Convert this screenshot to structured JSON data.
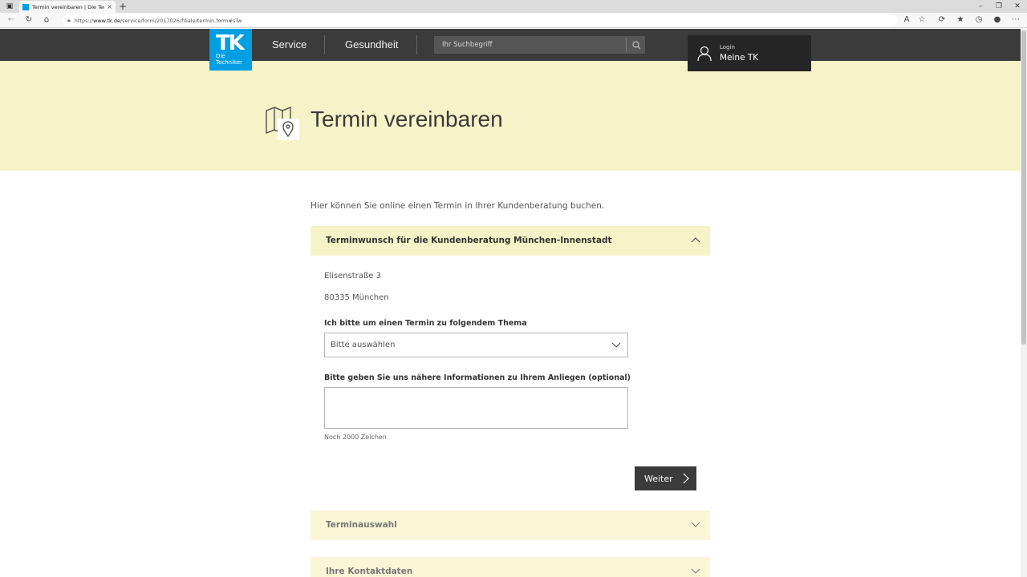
{
  "browser": {
    "tab_title": "Termin vereinbaren | Die Technik",
    "tab_close": "×",
    "new_tab": "+",
    "url_prefix": "https://",
    "url_host": "www.tk.de",
    "url_path": "/service/form/2017026/filiale/termin.form#sTw"
  },
  "header": {
    "logo_text": "TK",
    "logo_brand_line1": "Die",
    "logo_brand_line2": "Techniker",
    "nav": [
      "Service",
      "Gesundheit"
    ],
    "search_placeholder": "Ihr Suchbegriff",
    "login_small": "Login",
    "login_main": "Meine TK"
  },
  "hero": {
    "title": "Termin vereinbaren"
  },
  "main": {
    "intro": "Hier können Sie online einen Termin in Ihrer Kundenberatung buchen.",
    "panel1_title": "Terminwunsch für die Kundenberatung München-Innenstadt",
    "street": "Elisenstraße 3",
    "city": "80335 München",
    "topic_label": "Ich bitte um einen Termin zu folgendem Thema",
    "topic_value": "Bitte auswählen",
    "info_label": "Bitte geben Sie uns nähere Informationen zu Ihrem Anliegen (optional)",
    "info_value": "",
    "char_count": "Noch 2000 Zeichen",
    "next_label": "Weiter",
    "panel2_title": "Terminauswahl",
    "panel3_title": "Ihre Kontaktdaten"
  },
  "colors": {
    "brand_blue": "#009ee3",
    "header_dark": "#3b3b3b",
    "hero_yellow": "#f7f3c8"
  }
}
